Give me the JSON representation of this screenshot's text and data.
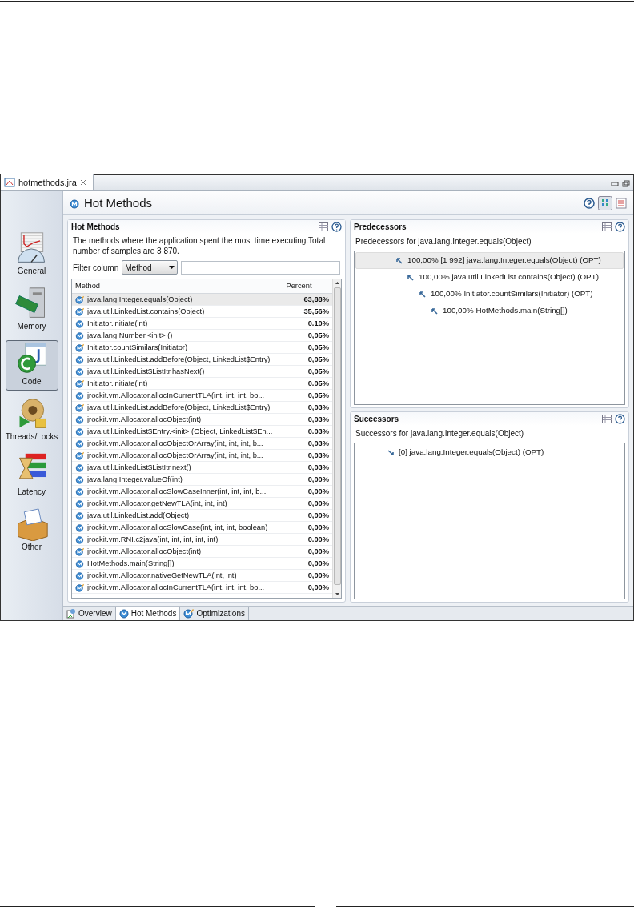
{
  "editor_tab": {
    "title": "hotmethods.jra"
  },
  "page_title": "Hot Methods",
  "sidebar": {
    "items": [
      {
        "label": "General",
        "kind": "general",
        "selected": false
      },
      {
        "label": "Memory",
        "kind": "memory",
        "selected": false
      },
      {
        "label": "Code",
        "kind": "code",
        "selected": true
      },
      {
        "label": "Threads/Locks",
        "kind": "threads",
        "selected": false
      },
      {
        "label": "Latency",
        "kind": "latency",
        "selected": false
      },
      {
        "label": "Other",
        "kind": "other",
        "selected": false
      }
    ]
  },
  "hot_methods": {
    "title": "Hot Methods",
    "description": "The methods where the application spent the most time executing.Total number of samples are 3 870.",
    "filter_label": "Filter column",
    "filter_select": "Method",
    "table": {
      "columns": [
        "Method",
        "Percent"
      ],
      "rows": [
        {
          "kind": "optimized",
          "method": "java.lang.Integer.equals(Object)",
          "percent": "63,88%",
          "selected": true
        },
        {
          "kind": "optimized",
          "method": "java.util.LinkedList.contains(Object)",
          "percent": "35,56%",
          "selected": false
        },
        {
          "kind": "plain",
          "method": "Initiator.initiate(int)",
          "percent": "0.10%",
          "selected": false
        },
        {
          "kind": "plain",
          "method": "java.lang.Number.<init> ()",
          "percent": "0,05%",
          "selected": false
        },
        {
          "kind": "optimized",
          "method": "Initiator.countSimilars(Initiator)",
          "percent": "0,05%",
          "selected": false
        },
        {
          "kind": "plain",
          "method": "java.util.LinkedList.addBefore(Object, LinkedList$Entry)",
          "percent": "0,05%",
          "selected": false
        },
        {
          "kind": "plain",
          "method": "java.util.LinkedList$ListItr.hasNext()",
          "percent": "0,05%",
          "selected": false
        },
        {
          "kind": "optimized",
          "method": "Initiator.initiate(int)",
          "percent": "0.05%",
          "selected": false
        },
        {
          "kind": "plain",
          "method": "jrockit.vm.Allocator.allocInCurrentTLA(int, int, int, bo...",
          "percent": "0,05%",
          "selected": false
        },
        {
          "kind": "optimized",
          "method": "java.util.LinkedList.addBefore(Object, LinkedList$Entry)",
          "percent": "0,03%",
          "selected": false
        },
        {
          "kind": "plain",
          "method": "jrockit.vm.Allocator.allocObject(int)",
          "percent": "0,03%",
          "selected": false
        },
        {
          "kind": "plain",
          "method": "java.util.LinkedList$Entry.<init> (Object, LinkedList$En...",
          "percent": "0.03%",
          "selected": false
        },
        {
          "kind": "plain",
          "method": "jrockit.vm.Allocator.allocObjectOrArray(int, int, int, b...",
          "percent": "0,03%",
          "selected": false
        },
        {
          "kind": "optimized",
          "method": "jrockit.vm.Allocator.allocObjectOrArray(int, int, int, b...",
          "percent": "0,03%",
          "selected": false
        },
        {
          "kind": "plain",
          "method": "java.util.LinkedList$ListItr.next()",
          "percent": "0,03%",
          "selected": false
        },
        {
          "kind": "plain",
          "method": "java.lang.Integer.valueOf(int)",
          "percent": "0,00%",
          "selected": false
        },
        {
          "kind": "plain",
          "method": "jrockit.vm.Allocator.allocSlowCaseInner(int, int, int, b...",
          "percent": "0,00%",
          "selected": false
        },
        {
          "kind": "plain",
          "method": "jrockit.vm.Allocator.getNewTLA(int, int, int)",
          "percent": "0,00%",
          "selected": false
        },
        {
          "kind": "plain",
          "method": "java.util.LinkedList.add(Object)",
          "percent": "0,00%",
          "selected": false
        },
        {
          "kind": "plain",
          "method": "jrockit.vm.Allocator.allocSlowCase(int, int, int, boolean)",
          "percent": "0,00%",
          "selected": false
        },
        {
          "kind": "plain",
          "method": "jrockit.vm.RNI.c2java(int, int, int, int, int)",
          "percent": "0.00%",
          "selected": false
        },
        {
          "kind": "optimized",
          "method": "jrockit.vm.Allocator.allocObject(int)",
          "percent": "0,00%",
          "selected": false
        },
        {
          "kind": "plain",
          "method": "HotMethods.main(String[])",
          "percent": "0,00%",
          "selected": false
        },
        {
          "kind": "plain",
          "method": "jrockit.vm.Allocator.nativeGetNewTLA(int, int)",
          "percent": "0,00%",
          "selected": false
        },
        {
          "kind": "optimized",
          "method": "jrockit.vm.Allocator.allocInCurrentTLA(int, int, int, bo...",
          "percent": "0,00%",
          "selected": false
        }
      ]
    }
  },
  "predecessors": {
    "title": "Predecessors",
    "subtitle": "Predecessors for  java.lang.Integer.equals(Object)",
    "tree": [
      {
        "label": "100,00% [1 992] java.lang.Integer.equals(Object) (OPT)",
        "selected": true,
        "children": [
          {
            "label": "100,00% java.util.LinkedList.contains(Object) (OPT)",
            "selected": false,
            "children": [
              {
                "label": "100,00% Initiator.countSimilars(Initiator) (OPT)",
                "selected": false,
                "children": [
                  {
                    "label": "100,00% HotMethods.main(String[])",
                    "selected": false
                  }
                ]
              }
            ]
          }
        ]
      }
    ]
  },
  "successors": {
    "title": "Successors",
    "subtitle": "Successors for  java.lang.Integer.equals(Object)",
    "tree": [
      {
        "label": "[0] java.lang.Integer.equals(Object) (OPT)",
        "selected": false
      }
    ]
  },
  "bottom_tabs": [
    {
      "label": "Overview",
      "kind": "overview",
      "selected": false
    },
    {
      "label": "Hot Methods",
      "kind": "method",
      "selected": true
    },
    {
      "label": "Optimizations",
      "kind": "optimized",
      "selected": false
    }
  ]
}
